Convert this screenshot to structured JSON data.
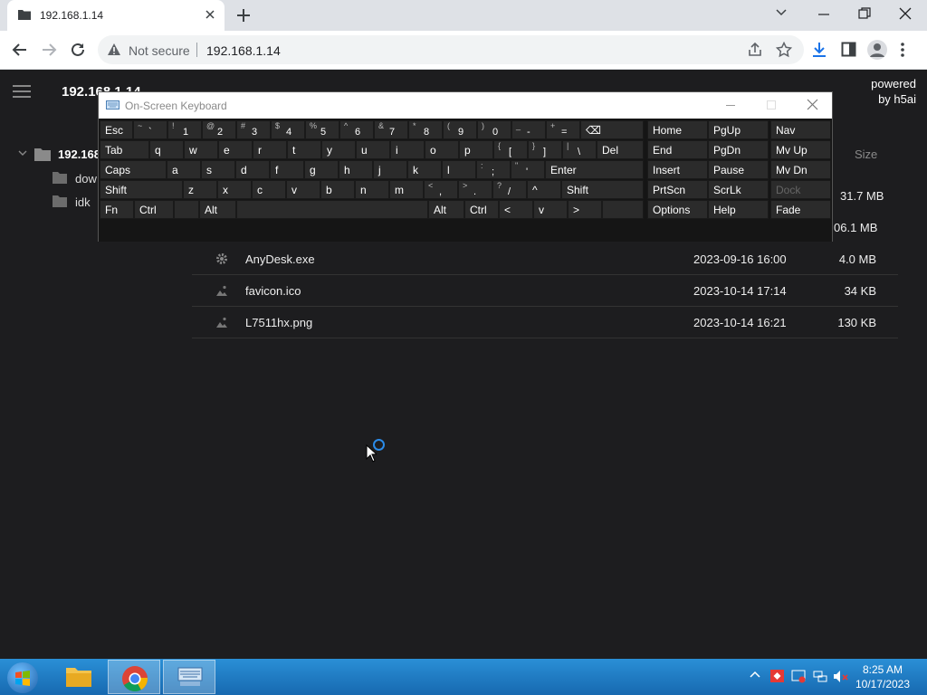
{
  "browser": {
    "tab_title": "192.168.1.14",
    "security_label": "Not secure",
    "url": "192.168.1.14"
  },
  "page": {
    "breadcrumb": "192.168.1.14",
    "powered_line1": "powered",
    "powered_line2": "by h5ai",
    "tree_root": "192.168",
    "tree_items": [
      "dow",
      "idk"
    ],
    "size_header": "Size",
    "partial_sizes": [
      "31.7 MB",
      "06.1 MB"
    ],
    "files": [
      {
        "name": "AnyDesk.exe",
        "date": "2023-09-16 16:00",
        "size": "4.0 MB",
        "icon": "gear-icon"
      },
      {
        "name": "favicon.ico",
        "date": "2023-10-14 17:14",
        "size": "34 KB",
        "icon": "image-icon"
      },
      {
        "name": "L7511hx.png",
        "date": "2023-10-14 16:21",
        "size": "130 KB",
        "icon": "image-icon"
      }
    ]
  },
  "osk": {
    "title": "On-Screen Keyboard",
    "row1": [
      {
        "sh": "",
        "mn": "",
        "lbl": "Esc"
      },
      {
        "sh": "~",
        "mn": "`"
      },
      {
        "sh": "!",
        "mn": "1"
      },
      {
        "sh": "@",
        "mn": "2"
      },
      {
        "sh": "#",
        "mn": "3"
      },
      {
        "sh": "$",
        "mn": "4"
      },
      {
        "sh": "%",
        "mn": "5"
      },
      {
        "sh": "^",
        "mn": "6"
      },
      {
        "sh": "&",
        "mn": "7"
      },
      {
        "sh": "*",
        "mn": "8"
      },
      {
        "sh": "(",
        "mn": "9"
      },
      {
        "sh": ")",
        "mn": "0"
      },
      {
        "sh": "_",
        "mn": "-"
      },
      {
        "sh": "+",
        "mn": "="
      },
      {
        "lbl": "⌫"
      }
    ],
    "row2": [
      "Tab",
      "q",
      "w",
      "e",
      "r",
      "t",
      "y",
      "u",
      "i",
      "o",
      "p"
    ],
    "row2_brackets": [
      {
        "sh": "{",
        "mn": "["
      },
      {
        "sh": "}",
        "mn": "]"
      },
      {
        "sh": "|",
        "mn": "\\"
      }
    ],
    "row2_end": "Del",
    "row3": [
      "Caps",
      "a",
      "s",
      "d",
      "f",
      "g",
      "h",
      "j",
      "k",
      "l"
    ],
    "row3_punct": [
      {
        "sh": ":",
        "mn": ";"
      },
      {
        "sh": "\"",
        "mn": "'"
      }
    ],
    "row3_end": "Enter",
    "row4": [
      "Shift",
      "z",
      "x",
      "c",
      "v",
      "b",
      "n",
      "m"
    ],
    "row4_punct": [
      {
        "sh": "<",
        "mn": ","
      },
      {
        "sh": ">",
        "mn": "."
      },
      {
        "sh": "?",
        "mn": "/"
      }
    ],
    "row4_up": "^",
    "row4_end": "Shift",
    "row5": [
      "Fn",
      "Ctrl",
      "",
      "Alt",
      "",
      "Alt",
      "Ctrl",
      "<",
      "v",
      ">",
      ""
    ],
    "nav1": [
      "Home",
      "End",
      "Insert",
      "PrtScn",
      "Options"
    ],
    "nav2": [
      "PgUp",
      "PgDn",
      "Pause",
      "ScrLk",
      "Help"
    ],
    "nav3": [
      "Nav",
      "Mv Up",
      "Mv Dn",
      "Dock",
      "Fade"
    ]
  },
  "taskbar": {
    "time": "8:25 AM",
    "date": "10/17/2023"
  }
}
